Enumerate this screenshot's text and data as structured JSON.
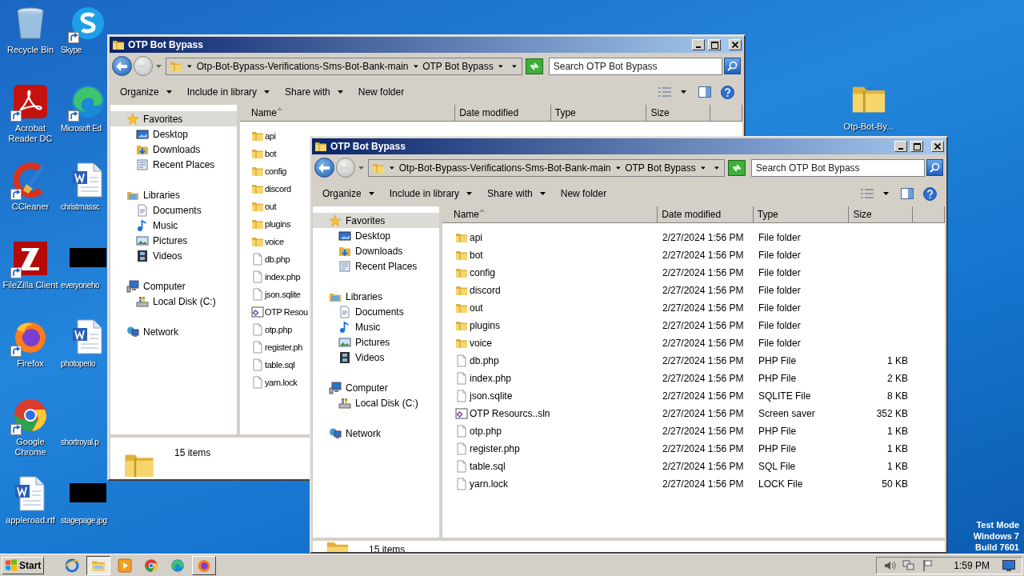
{
  "desktop": {
    "icons": [
      {
        "label": "Recycle Bin",
        "kind": "recycle",
        "shortcut": false
      },
      {
        "label": "Skype",
        "kind": "skype",
        "shortcut": true
      },
      {
        "label": "Acrobat Reader DC",
        "kind": "acrobat",
        "shortcut": true
      },
      {
        "label": "Microsoft Ed",
        "kind": "edge",
        "shortcut": true
      },
      {
        "label": "CCleaner",
        "kind": "ccleaner",
        "shortcut": true
      },
      {
        "label": "christmassc",
        "kind": "word",
        "shortcut": false
      },
      {
        "label": "FileZilla Client",
        "kind": "filezilla",
        "shortcut": true
      },
      {
        "label": "everyoneho",
        "kind": "image",
        "shortcut": false
      },
      {
        "label": "Firefox",
        "kind": "firefox",
        "shortcut": true
      },
      {
        "label": "photoperio",
        "kind": "word",
        "shortcut": false
      },
      {
        "label": "Google Chrome",
        "kind": "chrome",
        "shortcut": true
      },
      {
        "label": "shortroyal.p",
        "kind": "blank",
        "shortcut": false
      },
      {
        "label": "appleroad.rtf",
        "kind": "word",
        "shortcut": false
      },
      {
        "label": "stagepage.jpg",
        "kind": "image",
        "shortcut": false
      }
    ],
    "right_icon": {
      "label": "Otp-Bot-By...",
      "kind": "folder"
    },
    "edition_notice": [
      "Test Mode",
      "Windows 7",
      "Build 7601"
    ]
  },
  "windows": [
    {
      "title": "OTP Bot Bypass",
      "path": [
        "Otp-Bot-Bypass-Verifications-Sms-Bot-Bank-main",
        "OTP Bot Bypass"
      ],
      "search_placeholder": "Search OTP Bot Bypass",
      "toolbar": [
        {
          "label": "Organize",
          "dropdown": true
        },
        {
          "label": "Include in library",
          "dropdown": true
        },
        {
          "label": "Share with",
          "dropdown": true
        },
        {
          "label": "New folder",
          "dropdown": false
        }
      ],
      "sidebar": [
        {
          "label": "Favorites",
          "kind": "star",
          "selected": true,
          "children": [
            {
              "label": "Desktop",
              "kind": "desktop",
              "selected": false
            },
            {
              "label": "Downloads",
              "kind": "downloads",
              "selected": false
            },
            {
              "label": "Recent Places",
              "kind": "recent",
              "selected": false
            }
          ]
        },
        {
          "label": "Libraries",
          "kind": "library",
          "selected": false,
          "children": [
            {
              "label": "Documents",
              "kind": "documents",
              "selected": false
            },
            {
              "label": "Music",
              "kind": "music",
              "selected": false
            },
            {
              "label": "Pictures",
              "kind": "pictures",
              "selected": false
            },
            {
              "label": "Videos",
              "kind": "videos",
              "selected": false
            }
          ]
        },
        {
          "label": "Computer",
          "kind": "computer",
          "selected": false,
          "children": [
            {
              "label": "Local Disk (C:)",
              "kind": "disk",
              "selected": false
            }
          ]
        },
        {
          "label": "Network",
          "kind": "network",
          "selected": false
        }
      ],
      "columns": [
        {
          "label": "Name",
          "sorted": true
        },
        {
          "label": "Date modified",
          "sorted": false
        },
        {
          "label": "Type",
          "sorted": false
        },
        {
          "label": "Size",
          "sorted": false
        }
      ],
      "rows": [
        {
          "name": "api",
          "kind": "folder"
        },
        {
          "name": "bot",
          "kind": "folder"
        },
        {
          "name": "config",
          "kind": "folder"
        },
        {
          "name": "discord",
          "kind": "folder"
        },
        {
          "name": "out",
          "kind": "folder"
        },
        {
          "name": "plugins",
          "kind": "folder"
        },
        {
          "name": "voice",
          "kind": "folder"
        },
        {
          "name": "db.php",
          "kind": "file"
        },
        {
          "name": "index.php",
          "kind": "file"
        },
        {
          "name": "json.sqlite",
          "kind": "file"
        },
        {
          "name": "OTP Resou",
          "kind": "solution"
        },
        {
          "name": "otp.php",
          "kind": "file"
        },
        {
          "name": "register.ph",
          "kind": "file"
        },
        {
          "name": "table.sql",
          "kind": "file"
        },
        {
          "name": "yarn.lock",
          "kind": "file"
        }
      ],
      "status": "15 items"
    },
    {
      "title": "OTP Bot Bypass",
      "path": [
        "Otp-Bot-Bypass-Verifications-Sms-Bot-Bank-main",
        "OTP Bot Bypass"
      ],
      "search_placeholder": "Search OTP Bot Bypass",
      "toolbar": [
        {
          "label": "Organize",
          "dropdown": true
        },
        {
          "label": "Include in library",
          "dropdown": true
        },
        {
          "label": "Share with",
          "dropdown": true
        },
        {
          "label": "New folder",
          "dropdown": false
        }
      ],
      "sidebar": [
        {
          "label": "Favorites",
          "kind": "star",
          "selected": true,
          "children": [
            {
              "label": "Desktop",
              "kind": "desktop",
              "selected": false
            },
            {
              "label": "Downloads",
              "kind": "downloads",
              "selected": false
            },
            {
              "label": "Recent Places",
              "kind": "recent",
              "selected": false
            }
          ]
        },
        {
          "label": "Libraries",
          "kind": "library",
          "selected": false,
          "children": [
            {
              "label": "Documents",
              "kind": "documents",
              "selected": false
            },
            {
              "label": "Music",
              "kind": "music",
              "selected": false
            },
            {
              "label": "Pictures",
              "kind": "pictures",
              "selected": false
            },
            {
              "label": "Videos",
              "kind": "videos",
              "selected": false
            }
          ]
        },
        {
          "label": "Computer",
          "kind": "computer",
          "selected": false,
          "children": [
            {
              "label": "Local Disk (C:)",
              "kind": "disk",
              "selected": false
            }
          ]
        },
        {
          "label": "Network",
          "kind": "network",
          "selected": false
        }
      ],
      "columns": [
        {
          "label": "Name",
          "sorted": true
        },
        {
          "label": "Date modified",
          "sorted": false
        },
        {
          "label": "Type",
          "sorted": false
        },
        {
          "label": "Size",
          "sorted": false
        }
      ],
      "rows": [
        {
          "name": "api",
          "kind": "folder",
          "date": "2/27/2024 1:56 PM",
          "type": "File folder"
        },
        {
          "name": "bot",
          "kind": "folder",
          "date": "2/27/2024 1:56 PM",
          "type": "File folder"
        },
        {
          "name": "config",
          "kind": "folder",
          "date": "2/27/2024 1:56 PM",
          "type": "File folder"
        },
        {
          "name": "discord",
          "kind": "folder",
          "date": "2/27/2024 1:56 PM",
          "type": "File folder"
        },
        {
          "name": "out",
          "kind": "folder",
          "date": "2/27/2024 1:56 PM",
          "type": "File folder"
        },
        {
          "name": "plugins",
          "kind": "folder",
          "date": "2/27/2024 1:56 PM",
          "type": "File folder"
        },
        {
          "name": "voice",
          "kind": "folder",
          "date": "2/27/2024 1:56 PM",
          "type": "File folder"
        },
        {
          "name": "db.php",
          "kind": "file",
          "date": "2/27/2024 1:56 PM",
          "type": "PHP File",
          "size": "1 KB"
        },
        {
          "name": "index.php",
          "kind": "file",
          "date": "2/27/2024 1:56 PM",
          "type": "PHP File",
          "size": "2 KB"
        },
        {
          "name": "json.sqlite",
          "kind": "file",
          "date": "2/27/2024 1:56 PM",
          "type": "SQLITE File",
          "size": "8 KB"
        },
        {
          "name": "OTP Resourcs..sln",
          "kind": "solution",
          "date": "2/27/2024 1:56 PM",
          "type": "Screen saver",
          "size": "352 KB"
        },
        {
          "name": "otp.php",
          "kind": "file",
          "date": "2/27/2024 1:56 PM",
          "type": "PHP File",
          "size": "1 KB"
        },
        {
          "name": "register.php",
          "kind": "file",
          "date": "2/27/2024 1:56 PM",
          "type": "PHP File",
          "size": "1 KB"
        },
        {
          "name": "table.sql",
          "kind": "file",
          "date": "2/27/2024 1:56 PM",
          "type": "SQL File",
          "size": "1 KB"
        },
        {
          "name": "yarn.lock",
          "kind": "file",
          "date": "2/27/2024 1:56 PM",
          "type": "LOCK File",
          "size": "50 KB"
        }
      ],
      "status": "15 items"
    }
  ],
  "taskbar": {
    "start": "Start",
    "apps": [
      {
        "kind": "ie",
        "open": false,
        "pressed": false
      },
      {
        "kind": "explorer",
        "open": true,
        "pressed": true
      },
      {
        "kind": "media",
        "open": false,
        "pressed": false
      },
      {
        "kind": "chrome",
        "open": false,
        "pressed": false
      },
      {
        "kind": "edge",
        "open": false,
        "pressed": false
      },
      {
        "kind": "firefox",
        "open": true,
        "pressed": false
      }
    ],
    "tray": [
      {
        "kind": "speaker"
      },
      {
        "kind": "network"
      },
      {
        "kind": "flag"
      }
    ],
    "clock": "1:59 PM"
  }
}
